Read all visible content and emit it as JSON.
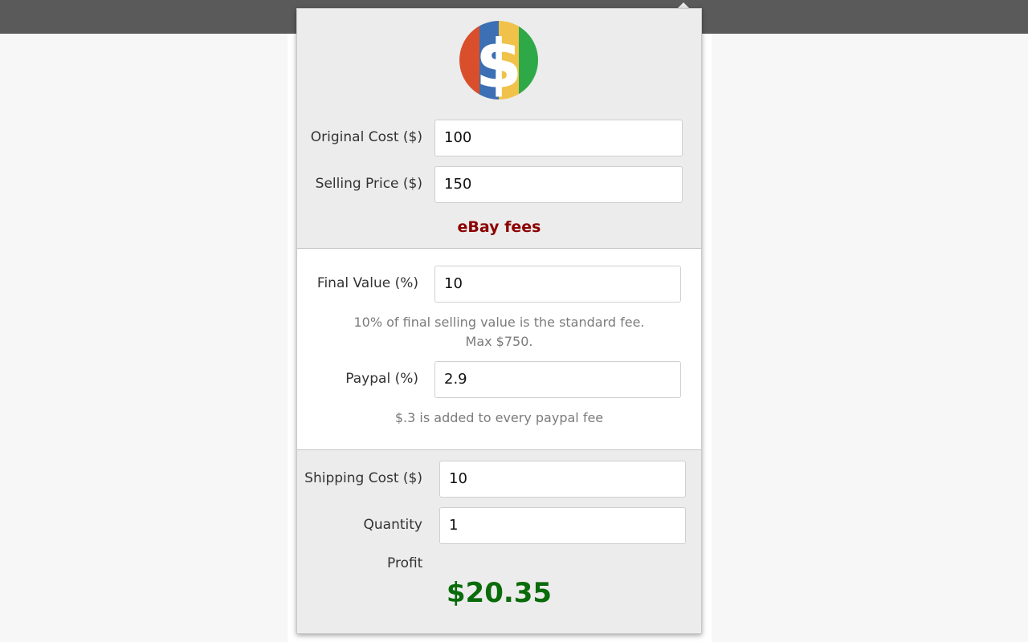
{
  "fields": {
    "original_cost": {
      "label": "Original Cost ($)",
      "value": "100"
    },
    "selling_price": {
      "label": "Selling Price ($)",
      "value": "150"
    },
    "final_value": {
      "label": "Final Value (%)",
      "value": "10"
    },
    "paypal": {
      "label": "Paypal (%)",
      "value": "2.9"
    },
    "shipping_cost": {
      "label": "Shipping Cost ($)",
      "value": "10"
    },
    "quantity": {
      "label": "Quantity",
      "value": "1"
    }
  },
  "fees_heading": "eBay fees",
  "notes": {
    "final_value_line1": "10% of final selling value is the standard fee.",
    "final_value_line2": "Max $750.",
    "paypal": "$.3 is added to every paypal fee"
  },
  "profit": {
    "label": "Profit",
    "value": "$20.35"
  },
  "logo": {
    "icon": "dollar-sign-icon",
    "symbol": "$",
    "colors": [
      "#d94f2b",
      "#3c6fb3",
      "#f1c24a",
      "#2fa847"
    ]
  }
}
